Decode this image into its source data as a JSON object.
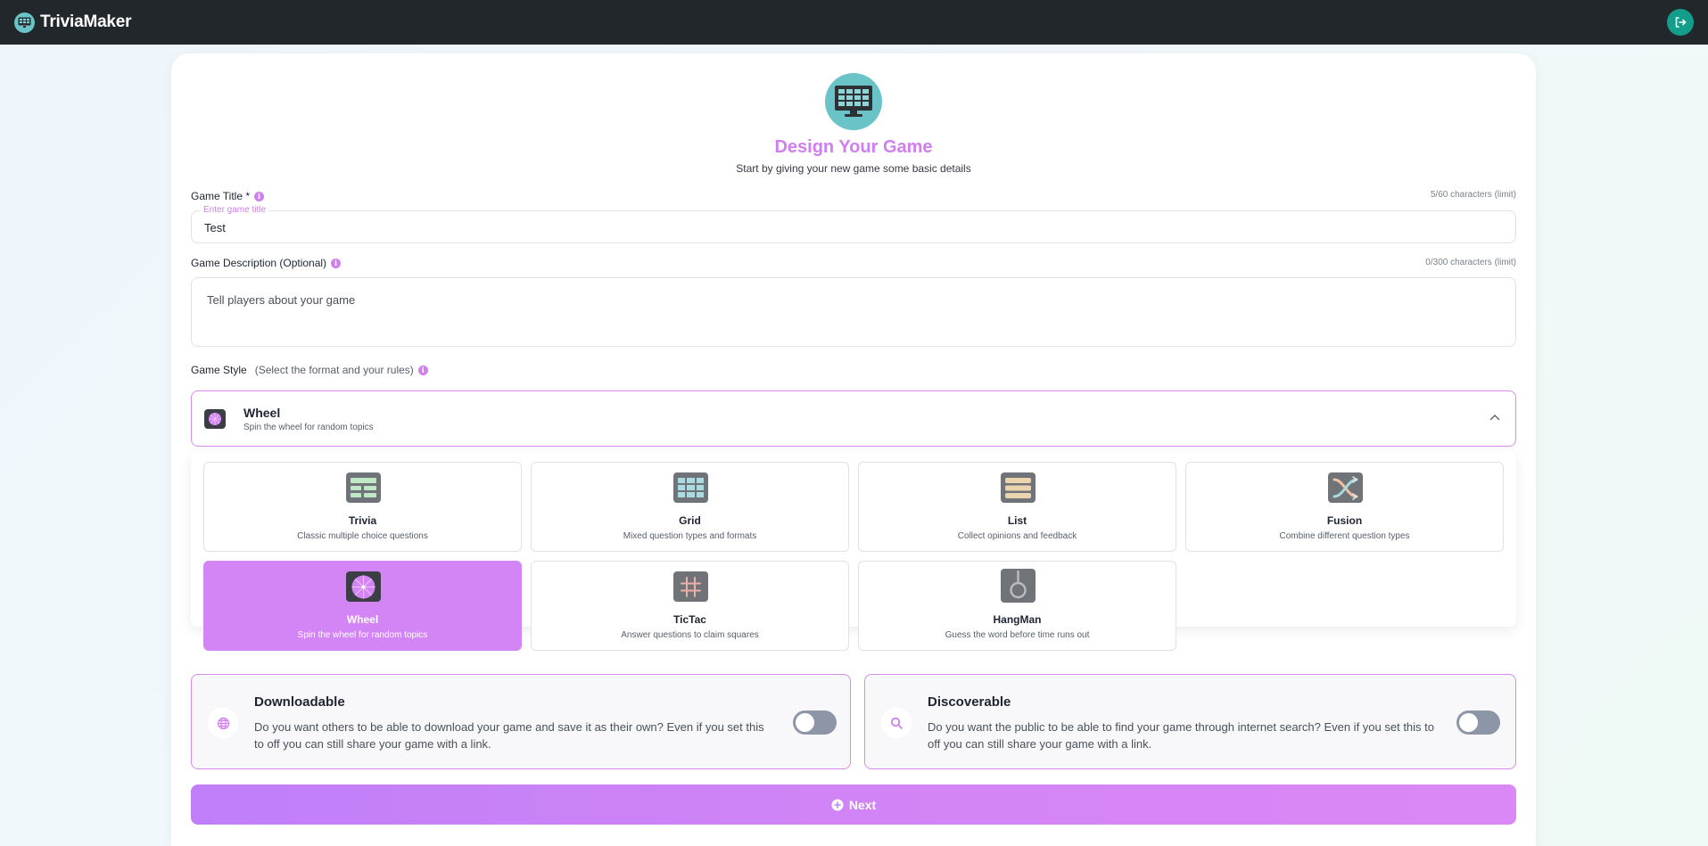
{
  "app": {
    "name": "TriviaMaker"
  },
  "header": {
    "logo_icon": "monitor-grid-icon",
    "logout_icon": "logout-icon"
  },
  "form": {
    "title": "Design Your Game",
    "subtitle": "Start by giving your new game some basic details",
    "game_title": {
      "label": "Game Title *",
      "placeholder": "Enter game title",
      "value": "Test",
      "char_count": "5/60 characters (limit)"
    },
    "game_description": {
      "label": "Game Description (Optional)",
      "placeholder": "Tell players about your game",
      "value": "",
      "char_count": "0/300 characters (limit)"
    },
    "game_style": {
      "label": "Game Style",
      "hint": "(Select the format and your rules)",
      "selected": {
        "name": "Wheel",
        "description": "Spin the wheel for random topics"
      },
      "options": [
        {
          "name": "Trivia",
          "description": "Classic multiple choice questions",
          "icon": "trivia-icon"
        },
        {
          "name": "Grid",
          "description": "Mixed question types and formats",
          "icon": "grid-icon"
        },
        {
          "name": "List",
          "description": "Collect opinions and feedback",
          "icon": "list-icon"
        },
        {
          "name": "Fusion",
          "description": "Combine different question types",
          "icon": "fusion-icon"
        },
        {
          "name": "Wheel",
          "description": "Spin the wheel for random topics",
          "icon": "wheel-icon"
        },
        {
          "name": "TicTac",
          "description": "Answer questions to claim squares",
          "icon": "tictac-icon"
        },
        {
          "name": "HangMan",
          "description": "Guess the word before time runs out",
          "icon": "hangman-icon"
        }
      ]
    },
    "downloadable": {
      "title": "Downloadable",
      "description": "Do you want others to be able to download your game and save it as their own? Even if you set this to off you can still share your game with a link.",
      "enabled": false
    },
    "discoverable": {
      "title": "Discoverable",
      "description": "Do you want the public to be able to find your game through internet search? Even if you set this to off you can still share your game with a link.",
      "enabled": false
    },
    "next_label": "Next"
  },
  "colors": {
    "accent": "#d17ef0",
    "topbar": "#22272b",
    "teal": "#6ac3c6",
    "logout": "#139d8b"
  }
}
